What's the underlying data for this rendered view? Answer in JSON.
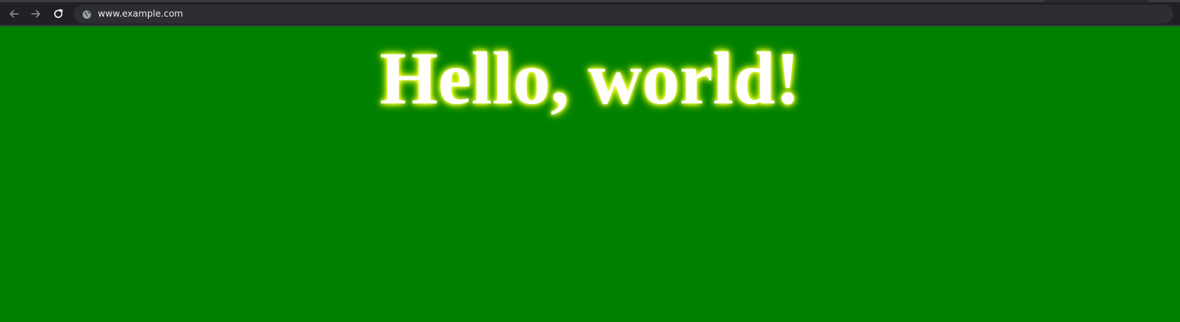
{
  "browser": {
    "url": "www.example.com",
    "icons": {
      "back": "arrow-left-icon",
      "forward": "arrow-right-icon",
      "reload": "reload-icon",
      "site_info": "globe-icon"
    },
    "colors": {
      "toolbar": "#202124",
      "omnibox": "#2d2e31",
      "url_text": "#e8eaed"
    }
  },
  "page": {
    "heading": "Hello, world!",
    "colors": {
      "background": "#008000",
      "heading_text": "#ffffff",
      "heading_glow": "#ffff00"
    }
  }
}
